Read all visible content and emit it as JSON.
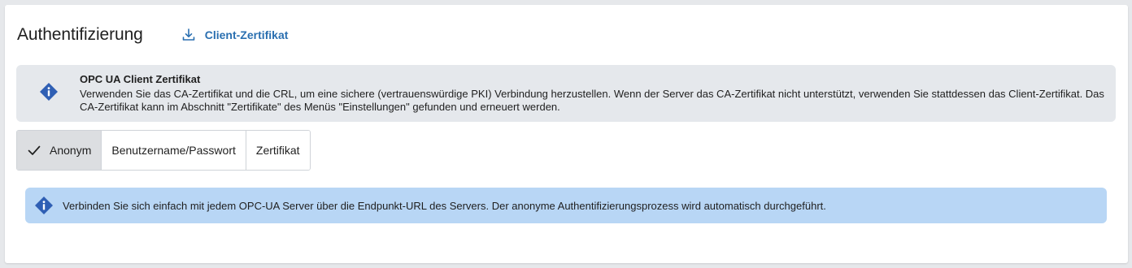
{
  "header": {
    "title": "Authentifizierung",
    "download_label": "Client-Zertifikat",
    "download_icon": "download-icon"
  },
  "notice": {
    "icon": "info-icon",
    "heading": "OPC UA Client Zertifikat",
    "body": "Verwenden Sie das CA-Zertifikat und die CRL, um eine sichere (vertrauenswürdige PKI) Verbindung herzustellen. Wenn der Server das CA-Zertifikat nicht unterstützt, verwenden Sie stattdessen das Client-Zertifikat. Das CA-Zertifikat kann im Abschnitt \"Zertifikate\" des Menüs \"Einstellungen\" gefunden und erneuert werden."
  },
  "auth_modes": {
    "selected": "Anonym",
    "options": [
      {
        "label": "Anonym"
      },
      {
        "label": "Benutzername/Passwort"
      },
      {
        "label": "Zertifikat"
      }
    ]
  },
  "info_bar": {
    "icon": "info-icon",
    "text": "Verbinden Sie sich einfach mit jedem OPC-UA Server über die Endpunkt-URL des Servers. Der anonyme Authentifizierungsprozess wird automatisch durchgeführt."
  },
  "colors": {
    "accent": "#2a6fb0",
    "info_icon": "#2f5fb4",
    "notice_bg": "#e5e8ec",
    "info_bar_bg": "#b8d6f5",
    "active_segment_bg": "#dcdee1"
  }
}
